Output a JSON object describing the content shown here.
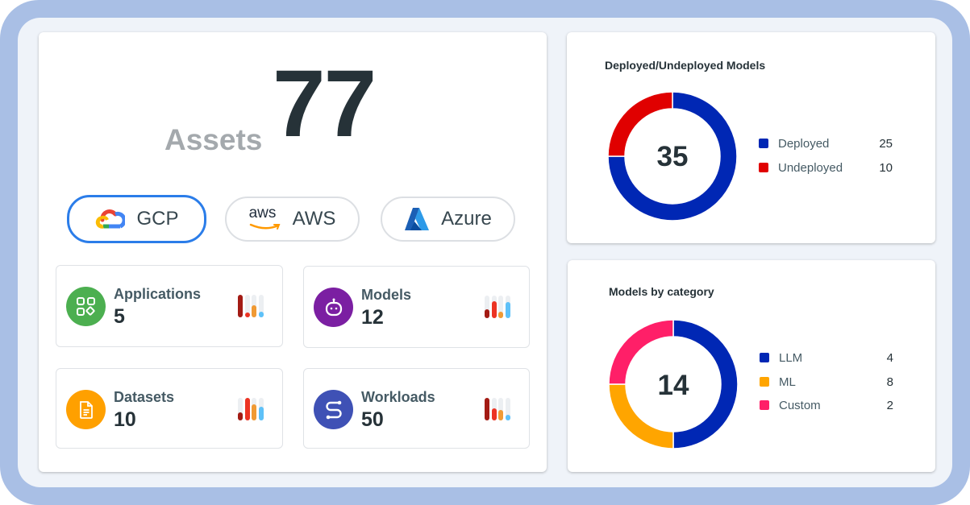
{
  "assets": {
    "label": "Assets",
    "total": "77"
  },
  "cloud_providers": [
    {
      "id": "gcp",
      "label": "GCP",
      "icon": "google-cloud-logo-icon",
      "active": true
    },
    {
      "id": "aws",
      "label": "AWS",
      "icon": "aws-logo-icon",
      "icon_text": "aws",
      "active": false
    },
    {
      "id": "azure",
      "label": "Azure",
      "icon": "azure-logo-icon",
      "active": false
    }
  ],
  "tiles": [
    {
      "id": "applications",
      "label": "Applications",
      "value": "5",
      "icon": "apps-grid-icon",
      "color": "#4caf50",
      "bars": [
        1.0,
        0.2,
        0.55,
        0.25
      ]
    },
    {
      "id": "models",
      "label": "Models",
      "value": "12",
      "icon": "robot-icon",
      "color": "#7b1fa2",
      "bars": [
        0.4,
        0.75,
        0.3,
        0.7
      ]
    },
    {
      "id": "datasets",
      "label": "Datasets",
      "value": "10",
      "icon": "document-icon",
      "color": "#ffa000",
      "bars": [
        0.35,
        1.0,
        0.7,
        0.6
      ]
    },
    {
      "id": "workloads",
      "label": "Workloads",
      "value": "50",
      "icon": "workflow-icon",
      "color": "#3f51b5",
      "bars": [
        1.0,
        0.55,
        0.45,
        0.25
      ]
    }
  ],
  "mini_bar_colors": [
    "#a31b14",
    "#ec3323",
    "#f09a34",
    "#5ec1f8"
  ],
  "chart_data": [
    {
      "type": "pie",
      "title": "Deployed/Undeployed Models",
      "center_label": "35",
      "categories": [
        "Deployed",
        "Undeployed"
      ],
      "values": [
        25,
        10
      ],
      "displayed_fractions": [
        0.75,
        0.25
      ],
      "colors": [
        "#0027b4",
        "#e00000"
      ],
      "legend": "right"
    },
    {
      "type": "pie",
      "title": "Models by category",
      "center_label": "14",
      "categories": [
        "LLM",
        "ML",
        "Custom"
      ],
      "values": [
        4,
        8,
        2
      ],
      "displayed_fractions": [
        0.5,
        0.25,
        0.25
      ],
      "colors": [
        "#0027b4",
        "#ffa500",
        "#ff1f68"
      ],
      "legend": "right"
    }
  ]
}
